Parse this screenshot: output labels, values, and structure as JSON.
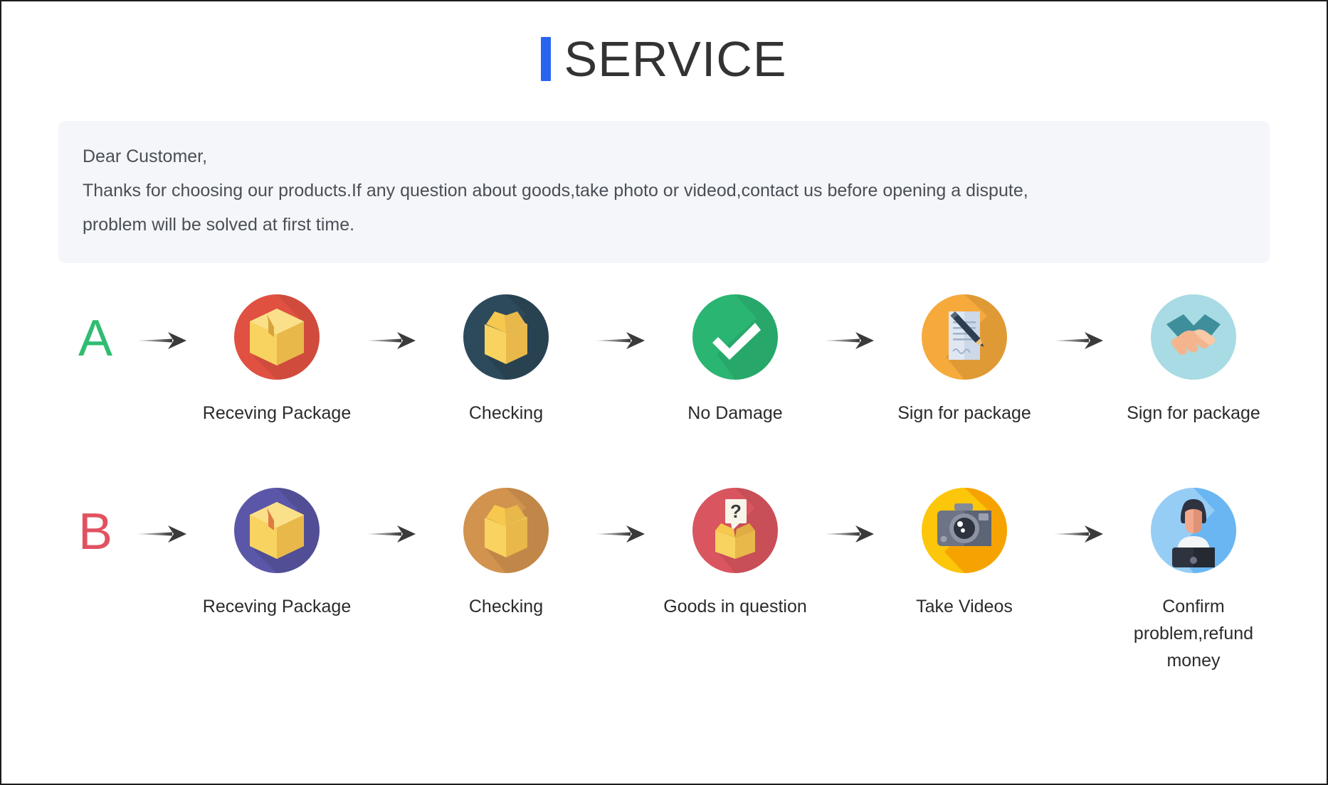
{
  "header": {
    "title": "SERVICE",
    "accent_color": "#2864f0"
  },
  "notice": {
    "line1": "Dear Customer,",
    "line2": "Thanks for choosing our products.If any question about goods,take photo or videod,contact us before opening a dispute,",
    "line3": "problem will be solved at first time.",
    "background_color": "#f4f6f9"
  },
  "flows": [
    {
      "badge": "A",
      "badge_color": "#2fbd72",
      "steps": [
        {
          "label": "Receving Package",
          "icon": "closed-box-icon",
          "circle_color": "#e05141"
        },
        {
          "label": "Checking",
          "icon": "open-box-icon",
          "circle_color": "#2d4a5c"
        },
        {
          "label": "No Damage",
          "icon": "check-mark-icon",
          "circle_color": "#2ab573"
        },
        {
          "label": "Sign for package",
          "icon": "document-pen-icon",
          "circle_color": "#f6aa3c"
        },
        {
          "label": "Sign for package",
          "icon": "handshake-icon",
          "circle_color": "#a8dbe3"
        }
      ]
    },
    {
      "badge": "B",
      "badge_color": "#e05260",
      "steps": [
        {
          "label": "Receving Package",
          "icon": "closed-box-icon",
          "circle_color": "#5b57a8"
        },
        {
          "label": "Checking",
          "icon": "open-box-icon",
          "circle_color": "#d2934f"
        },
        {
          "label": "Goods in question",
          "icon": "question-box-icon",
          "circle_color": "#d9555f"
        },
        {
          "label": "Take Videos",
          "icon": "camera-icon",
          "circle_color": "#fcc60a"
        },
        {
          "label": "Confirm problem,refund money",
          "icon": "support-agent-icon",
          "circle_color": "#96cdf5"
        }
      ]
    }
  ],
  "arrow": {
    "icon": "right-arrow-icon"
  }
}
